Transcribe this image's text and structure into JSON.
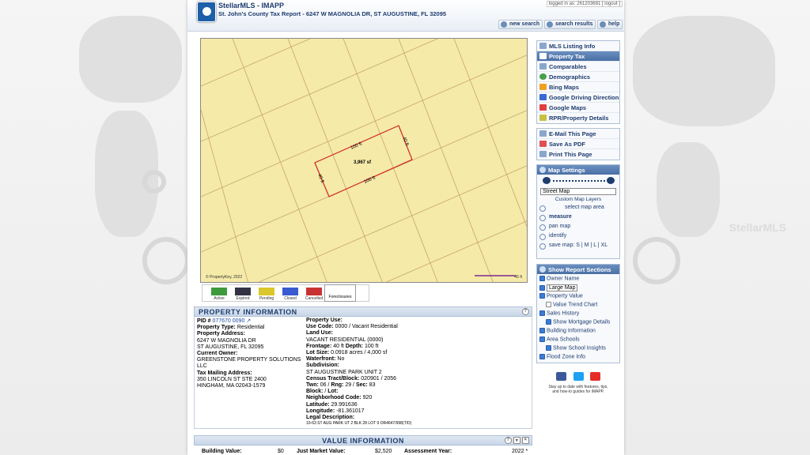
{
  "header": {
    "app_title": "StellarMLS - IMAPP",
    "subtitle": "St. John's County Tax Report - 6247 W MAGNOLIA DR, ST AUGUSTINE, FL 32095",
    "logged_in": "logged in as: 261203681 [ logout ]",
    "new_search": "new search",
    "search_results": "search results",
    "help": "help"
  },
  "watermark": "StellarMLS",
  "map": {
    "dim_top": "100 ft",
    "dim_right": "40 ft",
    "dim_left": "40 ft",
    "dim_bottom": "100 ft",
    "area": "3,967 sf",
    "copyright": "© PropertyKey, 2022",
    "scale_label": "45 ft"
  },
  "legend": {
    "active": "Active",
    "expired": "Expired",
    "pending": "Pending",
    "closed": "Closed",
    "cancelled": "Cancelled",
    "foreclosures": "Foreclosures"
  },
  "property_info": {
    "title": "PROPERTY INFORMATION",
    "pid_label": "PID #",
    "pid_value": "077670 0090",
    "type_label": "Property Type:",
    "type_value": "Residential",
    "address_label": "Property Address:",
    "address_line1": "6247 W MAGNOLIA DR",
    "address_line2": "ST AUGUSTINE, FL 32095",
    "owner_label": "Current Owner:",
    "owner_value": "GREENSTONE PROPERTY SOLUTIONS LLC",
    "mailing_label": "Tax Mailing Address:",
    "mailing_line1": "350 LINCOLN ST STE 2400",
    "mailing_line2": "HINGHAM, MA 02043-1579",
    "use_label": "Property Use:",
    "use_code_label": "Use Code:",
    "use_code_value": "0000 / Vacant Residential",
    "land_use_label": "Land Use:",
    "land_use_value": "VACANT RESIDENTIAL (0000)",
    "frontage_label": "Frontage:",
    "frontage_value": "40 ft",
    "depth_label": "Depth:",
    "depth_value": "100 ft",
    "lot_label": "Lot Size:",
    "lot_value": "0.0918 acres / 4,000 sf",
    "waterfront_label": "Waterfront:",
    "waterfront_value": "No",
    "subdivision_label": "Subdivision:",
    "subdivision_value": "ST AUGUSTINE PARK UNIT 2",
    "census_label": "Census Tract/Block:",
    "census_value": "020901 / 2056",
    "twn_label": "Twn:",
    "twn_value": "06",
    "rng_label": "Rng:",
    "rng_value": "29",
    "sec_label": "Sec:",
    "sec_value": "83",
    "block_label": "Block:",
    "lot2_label": "Lot:",
    "neighborhood_label": "Neighborhood Code:",
    "neighborhood_value": "920",
    "lat_label": "Latitude:",
    "lat_value": "29.991636",
    "lon_label": "Longitude:",
    "lon_value": "-81.361017",
    "legal_label": "Legal Description:",
    "legal_value": "10-63 ST AUG PARK UT 2 BLK 28 LOT 9 OR4647/998(T/D)"
  },
  "value_info": {
    "title": "VALUE INFORMATION",
    "building_label": "Building Value:",
    "building_value": "$0",
    "just_label": "Just Market Value:",
    "just_value": "$2,520",
    "assess_label": "Assessment Year:",
    "assess_value": "2022 *"
  },
  "sidebar": {
    "items": [
      {
        "label": "MLS Listing Info",
        "icon": "list-icon"
      },
      {
        "label": "Property Tax",
        "icon": "tax-icon"
      },
      {
        "label": "Comparables",
        "icon": "compare-icon"
      },
      {
        "label": "Demographics",
        "icon": "globe-icon"
      },
      {
        "label": "Bing Maps",
        "icon": "bing-icon"
      },
      {
        "label": "Google Driving Directions",
        "icon": "car-icon"
      },
      {
        "label": "Google Maps",
        "icon": "pin-icon"
      },
      {
        "label": "RPR/Property Details",
        "icon": "rpr-icon"
      }
    ],
    "actions": [
      {
        "label": "E-Mail This Page",
        "icon": "email-icon"
      },
      {
        "label": "Save As PDF",
        "icon": "pdf-icon"
      },
      {
        "label": "Print This Page",
        "icon": "print-icon"
      }
    ]
  },
  "map_settings": {
    "title": "Map Settings",
    "map_type": "Street Map",
    "custom_layers": "Custom Map Layers",
    "select_area": "select map area",
    "measure": "measure",
    "pan": "pan map",
    "identify": "identify",
    "save_map": "save map:",
    "s": "S",
    "m": "M",
    "l": "L",
    "xl": "XL"
  },
  "report_sections": {
    "title": "Show Report Sections",
    "owner_name": "Owner Name",
    "map_size": "Large Map",
    "property_value": "Property Value",
    "value_trend": "Value Trend Chart",
    "sales_history": "Sales History",
    "mortgage": "Show Mortgage Details",
    "building": "Building Information",
    "schools": "Area Schools",
    "school_insights": "Show School Insights",
    "flood": "Flood Zone Info"
  },
  "social": {
    "stay_line1": "Stay up to date with features, tips,",
    "stay_line2": "and how-to guides for iMAPP."
  },
  "colors": {
    "accent": "#4a6fa5",
    "map_bg": "#f5eaa8",
    "parcel": "#d22222"
  }
}
